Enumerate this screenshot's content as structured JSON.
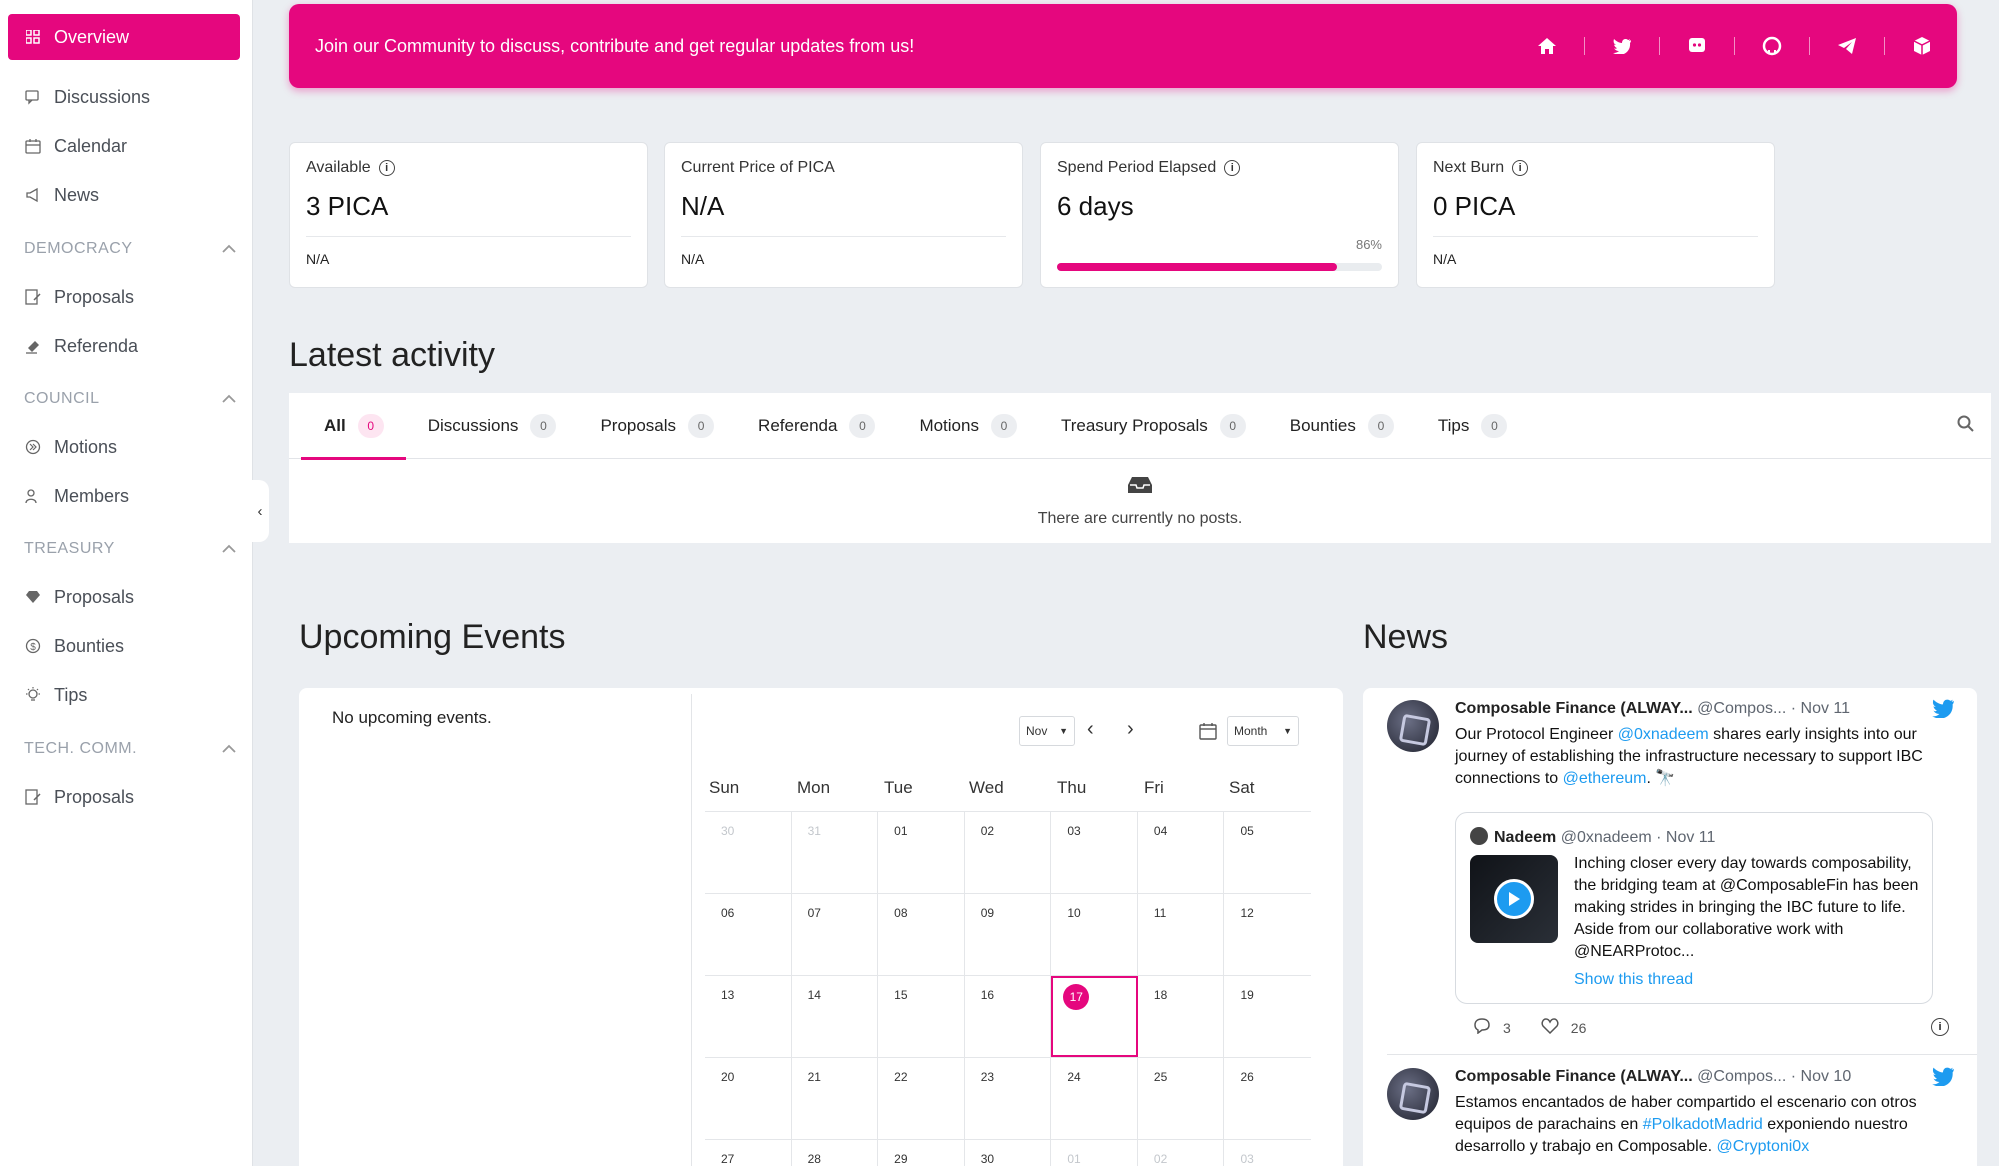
{
  "sidebar": {
    "active": "Overview",
    "top_items": [
      "Discussions",
      "Calendar",
      "News"
    ],
    "sections": [
      {
        "title": "DEMOCRACY",
        "items": [
          "Proposals",
          "Referenda"
        ]
      },
      {
        "title": "COUNCIL",
        "items": [
          "Motions",
          "Members"
        ]
      },
      {
        "title": "TREASURY",
        "items": [
          "Proposals",
          "Bounties",
          "Tips"
        ]
      },
      {
        "title": "TECH. COMM.",
        "items": [
          "Proposals"
        ]
      }
    ]
  },
  "banner": {
    "text": "Join our Community to discuss, contribute and get regular updates from us!",
    "icons": [
      "home-icon",
      "twitter-icon",
      "discord-icon",
      "github-icon",
      "telegram-icon",
      "cube-icon"
    ]
  },
  "stats": [
    {
      "label": "Available",
      "value": "3 PICA",
      "sub": "N/A",
      "info": true
    },
    {
      "label": "Current Price of PICA",
      "value": "N/A",
      "sub": "N/A",
      "info": false
    },
    {
      "label": "Spend Period Elapsed",
      "value": "6 days",
      "progress_pct": "86%",
      "progress": 0.86,
      "info": true
    },
    {
      "label": "Next Burn",
      "value": "0 PICA",
      "sub": "N/A",
      "info": true
    }
  ],
  "activity": {
    "title": "Latest activity",
    "tabs": [
      {
        "label": "All",
        "count": "0"
      },
      {
        "label": "Discussions",
        "count": "0"
      },
      {
        "label": "Proposals",
        "count": "0"
      },
      {
        "label": "Referenda",
        "count": "0"
      },
      {
        "label": "Motions",
        "count": "0"
      },
      {
        "label": "Treasury Proposals",
        "count": "0"
      },
      {
        "label": "Bounties",
        "count": "0"
      },
      {
        "label": "Tips",
        "count": "0"
      }
    ],
    "empty_text": "There are currently no posts."
  },
  "events": {
    "title": "Upcoming Events",
    "empty_text": "No upcoming events.",
    "month_select": "Nov",
    "view_select": "Month",
    "days": [
      "Sun",
      "Mon",
      "Tue",
      "Wed",
      "Thu",
      "Fri",
      "Sat"
    ],
    "weeks": [
      [
        "30",
        "31",
        "01",
        "02",
        "03",
        "04",
        "05"
      ],
      [
        "06",
        "07",
        "08",
        "09",
        "10",
        "11",
        "12"
      ],
      [
        "13",
        "14",
        "15",
        "16",
        "17",
        "18",
        "19"
      ],
      [
        "20",
        "21",
        "22",
        "23",
        "24",
        "25",
        "26"
      ],
      [
        "27",
        "28",
        "29",
        "30",
        "01",
        "02",
        "03"
      ]
    ],
    "today": "17"
  },
  "news": {
    "title": "News",
    "tweets": [
      {
        "name": "Composable Finance (ALWAY...",
        "handle": "@Compos...",
        "date": "· Nov 11",
        "text_parts": [
          "Our Protocol Engineer ",
          "@0xnadeem",
          " shares early insights into our journey of establishing the infrastructure necessary to support IBC connections to ",
          "@ethereum",
          ". 🔭"
        ],
        "quote": {
          "name": "Nadeem",
          "handle": "@0xnadeem",
          "date": "· Nov 11",
          "text": "Inching closer every day towards composability, the bridging team at @ComposableFin has been making strides in bringing the IBC future to life. Aside from our collaborative work with @NEARProtoc...",
          "link": "Show this thread"
        },
        "replies": "3",
        "likes": "26"
      },
      {
        "name": "Composable Finance (ALWAY...",
        "handle": "@Compos...",
        "date": "· Nov 10",
        "text_parts": [
          "Estamos encantados de haber compartido el escenario con otros equipos de parachains en ",
          "#PolkadotMadrid",
          " exponiendo nuestro desarrollo y trabajo en Composable. ",
          "@Cryptoni0x"
        ]
      }
    ]
  }
}
